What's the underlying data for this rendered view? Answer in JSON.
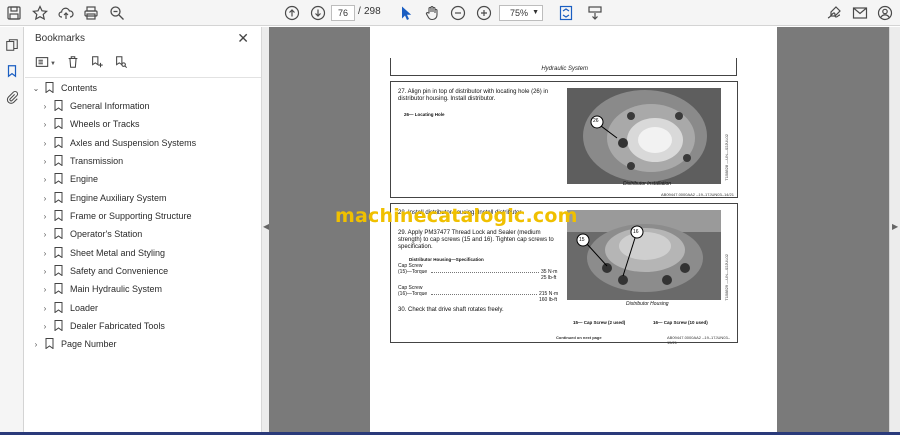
{
  "toolbar": {
    "page_current": "76",
    "page_separator": "/",
    "page_total": "298",
    "zoom": "75%"
  },
  "bookmarks": {
    "title": "Bookmarks",
    "items": [
      {
        "label": "Contents",
        "level": 0
      },
      {
        "label": "General Information",
        "level": 1
      },
      {
        "label": "Wheels or Tracks",
        "level": 1
      },
      {
        "label": "Axles and Suspension Systems",
        "level": 1
      },
      {
        "label": "Transmission",
        "level": 1
      },
      {
        "label": "Engine",
        "level": 1
      },
      {
        "label": "Engine Auxiliary System",
        "level": 1
      },
      {
        "label": "Frame or Supporting Structure",
        "level": 1
      },
      {
        "label": "Operator's Station",
        "level": 1
      },
      {
        "label": "Sheet Metal and Styling",
        "level": 1
      },
      {
        "label": "Safety and Convenience",
        "level": 1
      },
      {
        "label": "Main Hydraulic System",
        "level": 1
      },
      {
        "label": "Loader",
        "level": 1
      },
      {
        "label": "Dealer Fabricated Tools",
        "level": 1
      },
      {
        "label": "Page Number",
        "level": 0
      }
    ]
  },
  "document": {
    "header": "Hydraulic System",
    "step27": "27. Align pin in top of distributor with locating hole (26) in distributor housing. Install distributor.",
    "label26": "26— Locating Hole",
    "caption1": "Distributor Installation",
    "photo1_code": "T158828 —UN—02JUL02",
    "ref1": "AB09447.0000AA2 –19–17JUN03–14/21",
    "step28": "28. Install distributor housing. Install distributor",
    "step29": "29. Apply PM37477 Thread Lock and Sealer (medium strength) to cap screws (15 and 16). Tighten cap screws to specification.",
    "spec_title": "Distributor Housing—Specification",
    "spec1_a": "Cap Screw",
    "spec1_b": "(15)—Torque",
    "spec1_v1": "35 N·m",
    "spec1_v2": "25 lb-ft",
    "spec2_a": "Cap Screw",
    "spec2_b": "(16)—Torque",
    "spec2_v1": "215 N·m",
    "spec2_v2": "160 lb-ft",
    "step30": "30. Check that drive shaft rotates freely.",
    "caption2": "Distributor Housing",
    "photo2_code": "T158829 —UN—02JUL02",
    "legend15": "15— Cap Screw (2 used)",
    "legend16": "16— Cap Screw (10 used)",
    "continued": "Continued on next page",
    "ref2": "AB09447.0000AA2 –19–17JUN03–15/21",
    "callout26": "26",
    "callout15": "15",
    "callout16": "16"
  },
  "watermark": "machinecatalogic.com"
}
